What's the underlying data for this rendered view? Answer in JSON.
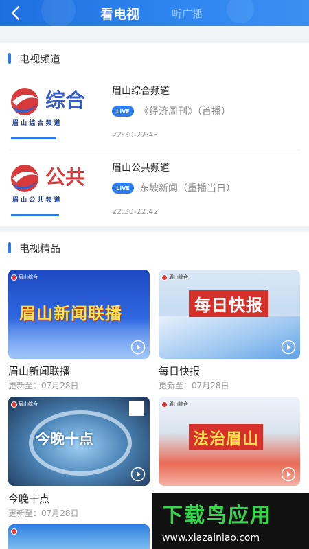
{
  "header": {
    "tab_tv": "看电视",
    "tab_radio": "听广播"
  },
  "channels_section": {
    "title": "电视频道",
    "items": [
      {
        "logo_text": "综合",
        "logo_sub": "眉 山 综 合 频 道",
        "name": "眉山综合频道",
        "badge": "LIVE",
        "program": "《经济周刊》（首播）",
        "time": "22:30-22:43"
      },
      {
        "logo_text": "公共",
        "logo_sub": "眉 山 公 共 频 道",
        "name": "眉山公共频道",
        "badge": "LIVE",
        "program": "东坡新闻（重播当日）",
        "time": "22:30-22:42"
      }
    ]
  },
  "featured_section": {
    "title": "电视精品",
    "cards": [
      {
        "thumb_text": "眉山新闻联播",
        "title": "眉山新闻联播",
        "updated": "更新至：07月28日",
        "brand": "眉山综合"
      },
      {
        "thumb_text": "每日快报",
        "title": "每日快报",
        "updated": "更新至：07月28日",
        "brand": "眉山综合"
      },
      {
        "thumb_text": "今晚十点",
        "title": "今晚十点",
        "updated": "更新至：07月28日",
        "brand": "眉山综合"
      },
      {
        "thumb_text": "法治眉山",
        "title": "",
        "updated": "",
        "brand": "眉山综合"
      }
    ]
  },
  "watermark": {
    "brand": "下载鸟应用",
    "url": "www.xiazainiao.com"
  },
  "colors": {
    "accent": "#2c7cf0",
    "header_start": "#1d6fe0",
    "logo_red": "#d63a3a",
    "logo_blue": "#3a5fc4"
  }
}
